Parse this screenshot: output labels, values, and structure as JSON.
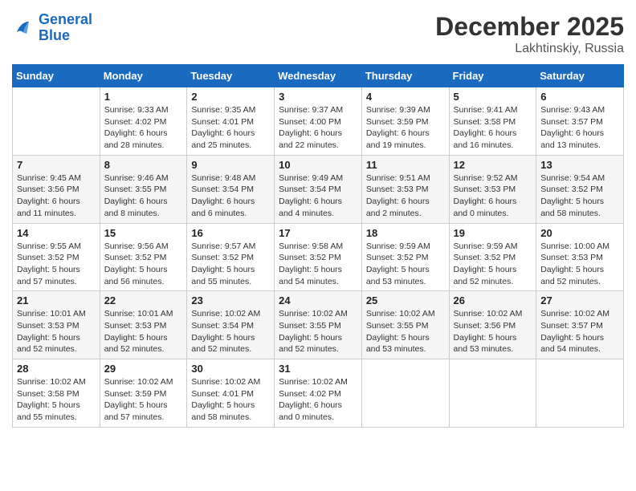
{
  "logo": {
    "line1": "General",
    "line2": "Blue"
  },
  "title": "December 2025",
  "location": "Lakhtinskiy, Russia",
  "days_header": [
    "Sunday",
    "Monday",
    "Tuesday",
    "Wednesday",
    "Thursday",
    "Friday",
    "Saturday"
  ],
  "weeks": [
    [
      {
        "day": "",
        "info": ""
      },
      {
        "day": "1",
        "info": "Sunrise: 9:33 AM\nSunset: 4:02 PM\nDaylight: 6 hours\nand 28 minutes."
      },
      {
        "day": "2",
        "info": "Sunrise: 9:35 AM\nSunset: 4:01 PM\nDaylight: 6 hours\nand 25 minutes."
      },
      {
        "day": "3",
        "info": "Sunrise: 9:37 AM\nSunset: 4:00 PM\nDaylight: 6 hours\nand 22 minutes."
      },
      {
        "day": "4",
        "info": "Sunrise: 9:39 AM\nSunset: 3:59 PM\nDaylight: 6 hours\nand 19 minutes."
      },
      {
        "day": "5",
        "info": "Sunrise: 9:41 AM\nSunset: 3:58 PM\nDaylight: 6 hours\nand 16 minutes."
      },
      {
        "day": "6",
        "info": "Sunrise: 9:43 AM\nSunset: 3:57 PM\nDaylight: 6 hours\nand 13 minutes."
      }
    ],
    [
      {
        "day": "7",
        "info": "Sunrise: 9:45 AM\nSunset: 3:56 PM\nDaylight: 6 hours\nand 11 minutes."
      },
      {
        "day": "8",
        "info": "Sunrise: 9:46 AM\nSunset: 3:55 PM\nDaylight: 6 hours\nand 8 minutes."
      },
      {
        "day": "9",
        "info": "Sunrise: 9:48 AM\nSunset: 3:54 PM\nDaylight: 6 hours\nand 6 minutes."
      },
      {
        "day": "10",
        "info": "Sunrise: 9:49 AM\nSunset: 3:54 PM\nDaylight: 6 hours\nand 4 minutes."
      },
      {
        "day": "11",
        "info": "Sunrise: 9:51 AM\nSunset: 3:53 PM\nDaylight: 6 hours\nand 2 minutes."
      },
      {
        "day": "12",
        "info": "Sunrise: 9:52 AM\nSunset: 3:53 PM\nDaylight: 6 hours\nand 0 minutes."
      },
      {
        "day": "13",
        "info": "Sunrise: 9:54 AM\nSunset: 3:52 PM\nDaylight: 5 hours\nand 58 minutes."
      }
    ],
    [
      {
        "day": "14",
        "info": "Sunrise: 9:55 AM\nSunset: 3:52 PM\nDaylight: 5 hours\nand 57 minutes."
      },
      {
        "day": "15",
        "info": "Sunrise: 9:56 AM\nSunset: 3:52 PM\nDaylight: 5 hours\nand 56 minutes."
      },
      {
        "day": "16",
        "info": "Sunrise: 9:57 AM\nSunset: 3:52 PM\nDaylight: 5 hours\nand 55 minutes."
      },
      {
        "day": "17",
        "info": "Sunrise: 9:58 AM\nSunset: 3:52 PM\nDaylight: 5 hours\nand 54 minutes."
      },
      {
        "day": "18",
        "info": "Sunrise: 9:59 AM\nSunset: 3:52 PM\nDaylight: 5 hours\nand 53 minutes."
      },
      {
        "day": "19",
        "info": "Sunrise: 9:59 AM\nSunset: 3:52 PM\nDaylight: 5 hours\nand 52 minutes."
      },
      {
        "day": "20",
        "info": "Sunrise: 10:00 AM\nSunset: 3:53 PM\nDaylight: 5 hours\nand 52 minutes."
      }
    ],
    [
      {
        "day": "21",
        "info": "Sunrise: 10:01 AM\nSunset: 3:53 PM\nDaylight: 5 hours\nand 52 minutes."
      },
      {
        "day": "22",
        "info": "Sunrise: 10:01 AM\nSunset: 3:53 PM\nDaylight: 5 hours\nand 52 minutes."
      },
      {
        "day": "23",
        "info": "Sunrise: 10:02 AM\nSunset: 3:54 PM\nDaylight: 5 hours\nand 52 minutes."
      },
      {
        "day": "24",
        "info": "Sunrise: 10:02 AM\nSunset: 3:55 PM\nDaylight: 5 hours\nand 52 minutes."
      },
      {
        "day": "25",
        "info": "Sunrise: 10:02 AM\nSunset: 3:55 PM\nDaylight: 5 hours\nand 53 minutes."
      },
      {
        "day": "26",
        "info": "Sunrise: 10:02 AM\nSunset: 3:56 PM\nDaylight: 5 hours\nand 53 minutes."
      },
      {
        "day": "27",
        "info": "Sunrise: 10:02 AM\nSunset: 3:57 PM\nDaylight: 5 hours\nand 54 minutes."
      }
    ],
    [
      {
        "day": "28",
        "info": "Sunrise: 10:02 AM\nSunset: 3:58 PM\nDaylight: 5 hours\nand 55 minutes."
      },
      {
        "day": "29",
        "info": "Sunrise: 10:02 AM\nSunset: 3:59 PM\nDaylight: 5 hours\nand 57 minutes."
      },
      {
        "day": "30",
        "info": "Sunrise: 10:02 AM\nSunset: 4:01 PM\nDaylight: 5 hours\nand 58 minutes."
      },
      {
        "day": "31",
        "info": "Sunrise: 10:02 AM\nSunset: 4:02 PM\nDaylight: 6 hours\nand 0 minutes."
      },
      {
        "day": "",
        "info": ""
      },
      {
        "day": "",
        "info": ""
      },
      {
        "day": "",
        "info": ""
      }
    ]
  ]
}
